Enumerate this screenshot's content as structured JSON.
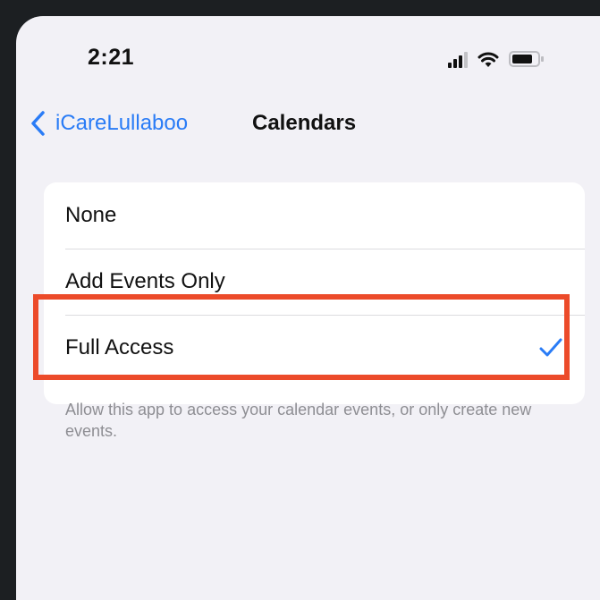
{
  "status_bar": {
    "time": "2:21",
    "icons": [
      "signal-icon",
      "wifi-icon",
      "battery-icon"
    ]
  },
  "nav": {
    "back_label": "iCareLullaboo",
    "title": "Calendars"
  },
  "options": [
    {
      "label": "None",
      "selected": false
    },
    {
      "label": "Add Events Only",
      "selected": false
    },
    {
      "label": "Full Access",
      "selected": true
    }
  ],
  "footer_text": "Allow this app to access your calendar events, or only create new events.",
  "colors": {
    "accent": "#2a7cf6",
    "highlight": "#ec4b2a",
    "background": "#f2f1f6"
  }
}
